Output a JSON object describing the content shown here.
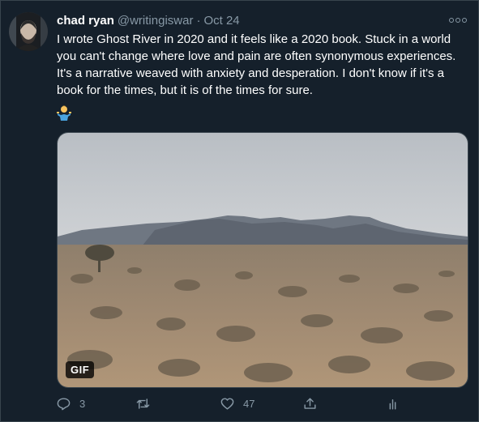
{
  "tweet": {
    "author_name": "chad ryan",
    "handle": "@writingiswar",
    "separator": "·",
    "date": "Oct 24",
    "text": "I wrote Ghost River in 2020 and it feels like a 2020 book. Stuck in a world you can't change where love and pain are often synonymous experiences. It's a narrative weaved with anxiety and desperation. I don't know if it's a book for the times, but it is of the times for sure.",
    "emoji_icon": "person-shrugging-icon",
    "media": {
      "type": "gif",
      "badge": "GIF",
      "description_icon": "desert-landscape"
    },
    "actions": {
      "reply_count": "3",
      "retweet_count": "",
      "like_count": "47"
    }
  },
  "colors": {
    "background": "#15202b",
    "border": "#38444d",
    "secondary_text": "#8899a6",
    "primary_text": "#ffffff"
  }
}
